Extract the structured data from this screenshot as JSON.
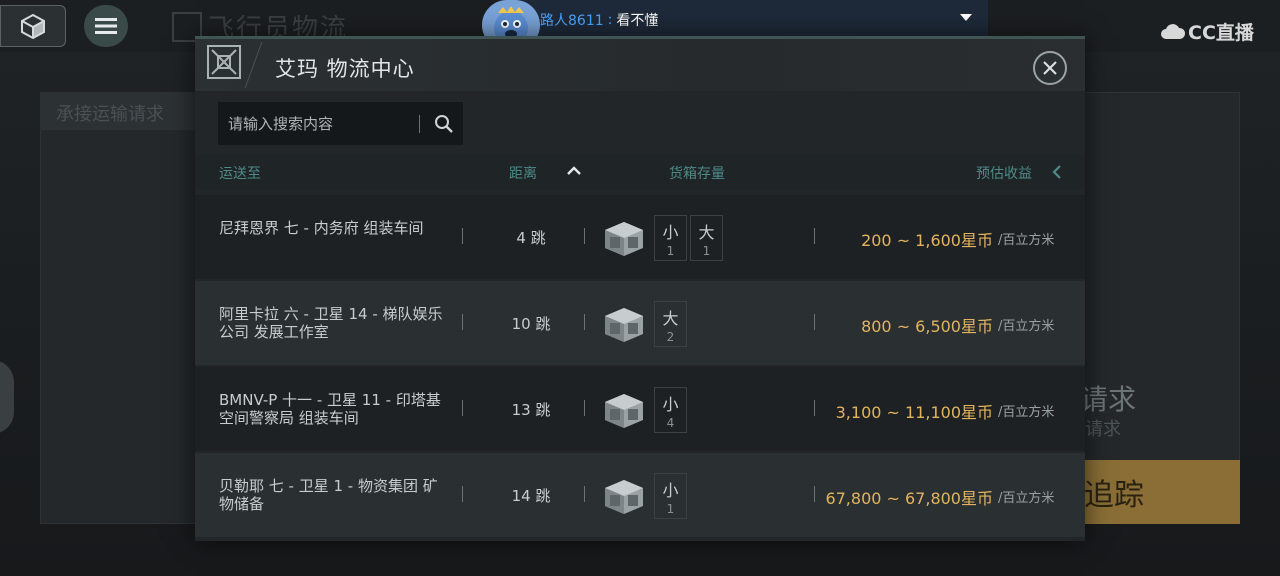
{
  "background": {
    "page_title": "飞行员物流",
    "panel_label": "承接运输请求",
    "request_big": "请求",
    "request_small": "请求",
    "track_button": "追踪"
  },
  "stream": {
    "chat_user": "路人8611",
    "chat_separator": ":",
    "chat_message": "看不懂",
    "platform_logo": "CC直播"
  },
  "modal": {
    "title": "艾玛 物流中心",
    "search_placeholder": "请输入搜索内容",
    "columns": {
      "destination": "运送至",
      "distance": "距离",
      "inventory": "货箱存量",
      "reward": "预估收益"
    },
    "rows": [
      {
        "destination": "尼拜恩界 七 - 内务府 组装车间",
        "jumps": "4 跳",
        "crates": [
          {
            "size": "小",
            "count": "1"
          },
          {
            "size": "大",
            "count": "1"
          }
        ],
        "reward": "200 ~ 1,600星币",
        "unit": "/百立方米"
      },
      {
        "destination": "阿里卡拉 六 - 卫星 14 - 梯队娱乐公司 发展工作室",
        "jumps": "10 跳",
        "crates": [
          {
            "size": "大",
            "count": "2"
          }
        ],
        "reward": "800 ~ 6,500星币",
        "unit": "/百立方米"
      },
      {
        "destination": "BMNV-P 十一 - 卫星 11 - 印塔基空间警察局 组装车间",
        "jumps": "13 跳",
        "crates": [
          {
            "size": "小",
            "count": "4"
          }
        ],
        "reward": "3,100 ~ 11,100星币",
        "unit": "/百立方米"
      },
      {
        "destination": "贝勒耶 七 - 卫星 1 - 物资集团 矿物储备",
        "jumps": "14 跳",
        "crates": [
          {
            "size": "小",
            "count": "1"
          }
        ],
        "reward": "67,800 ~ 67,800星币",
        "unit": "/百立方米"
      }
    ]
  },
  "colors": {
    "accent_teal": "#4e8a88",
    "reward_gold": "#e3b45f",
    "chat_user_blue": "#4ea6ff"
  }
}
